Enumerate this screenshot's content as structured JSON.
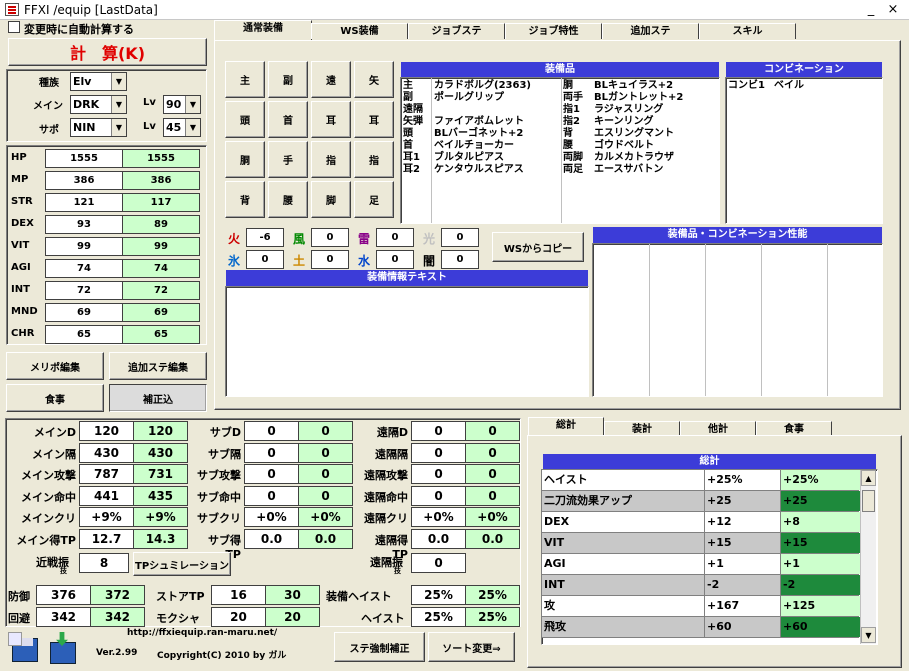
{
  "window": {
    "title": "FFXI /equip [LastData]",
    "minimize": "_",
    "close": "×"
  },
  "left": {
    "auto_calc_label": "変更時に自動計算する",
    "calc_button": "計　算(K)",
    "race_label": "種族",
    "race_value": "Elv",
    "main_label": "メイン",
    "main_value": "DRK",
    "sub_label": "サポ",
    "sub_value": "NIN",
    "lv_label": "Lv",
    "main_lv": "90",
    "sub_lv": "45",
    "stats": [
      {
        "name": "HP",
        "base": "1555",
        "total": "1555"
      },
      {
        "name": "MP",
        "base": "386",
        "total": "386"
      },
      {
        "name": "STR",
        "base": "121",
        "total": "117"
      },
      {
        "name": "DEX",
        "base": "93",
        "total": "89"
      },
      {
        "name": "VIT",
        "base": "99",
        "total": "99"
      },
      {
        "name": "AGI",
        "base": "74",
        "total": "74"
      },
      {
        "name": "INT",
        "base": "72",
        "total": "72"
      },
      {
        "name": "MND",
        "base": "69",
        "total": "69"
      },
      {
        "name": "CHR",
        "base": "65",
        "total": "65"
      }
    ],
    "merit_button": "メリポ編集",
    "extra_button": "追加ステ編集",
    "food_button": "食事",
    "correct_button": "補正込"
  },
  "tabs": [
    "通常装備",
    "WS装備",
    "ジョブステ",
    "ジョブ特性",
    "追加ステ",
    "スキル"
  ],
  "slots": [
    "主",
    "副",
    "遠",
    "矢",
    "頭",
    "首",
    "耳",
    "耳",
    "胴",
    "手",
    "指",
    "指",
    "背",
    "腰",
    "脚",
    "足"
  ],
  "equipment": {
    "header": "装備品",
    "left_slots": "主\n副\n遠隔\n矢弾\n頭\n首\n耳1\n耳2",
    "left_items": "カラドボルグ(2363)\nポールグリップ\n\nファイアボムレット\nBLバーゴネット+2\nベイルチョーカー\nブルタルピアス\nケンタウルスピアス",
    "right_slots": "胴\n両手\n指1\n指2\n背\n腰\n両脚\n両足",
    "right_items": "BLキュイラス+2\nBLガントレット+2\nラジャスリング\nキーンリング\nエスリングマント\nゴウドベルト\nカルメカトラウザ\nエースサバトン"
  },
  "combination": {
    "header": "コンビネーション",
    "label": "コンビ1",
    "value": "ベイル"
  },
  "elements": [
    {
      "name": "火",
      "value": "-6",
      "color": "#cc0000"
    },
    {
      "name": "風",
      "value": "0",
      "color": "#008800"
    },
    {
      "name": "雷",
      "value": "0",
      "color": "#880088"
    },
    {
      "name": "光",
      "value": "0",
      "color": "#c0c0c0"
    },
    {
      "name": "氷",
      "value": "0",
      "color": "#0066cc"
    },
    {
      "name": "土",
      "value": "0",
      "color": "#cc8800"
    },
    {
      "name": "水",
      "value": "0",
      "color": "#0044cc"
    },
    {
      "name": "闇",
      "value": "0",
      "color": "#000000"
    }
  ],
  "ws_copy_button": "WSからコピー",
  "equip_info_header": "装備情報テキスト",
  "combo_perf_header": "装備品・コンビネーション性能",
  "bottom": {
    "main": [
      {
        "label": "メインD",
        "a": "120",
        "b": "120"
      },
      {
        "label": "メイン隔",
        "a": "430",
        "b": "430"
      },
      {
        "label": "メイン攻撃",
        "a": "787",
        "b": "731"
      },
      {
        "label": "メイン命中",
        "a": "441",
        "b": "435"
      },
      {
        "label": "メインクリ",
        "a": "+9%",
        "b": "+9%"
      },
      {
        "label": "メイン得TP",
        "a": "12.7",
        "b": "14.3"
      }
    ],
    "sub": [
      {
        "label": "サブD",
        "a": "0",
        "b": "0"
      },
      {
        "label": "サブ隔",
        "a": "0",
        "b": "0"
      },
      {
        "label": "サブ攻撃",
        "a": "0",
        "b": "0"
      },
      {
        "label": "サブ命中",
        "a": "0",
        "b": "0"
      },
      {
        "label": "サブクリ",
        "a": "+0%",
        "b": "+0%"
      },
      {
        "label": "サブ得TP",
        "a": "0.0",
        "b": "0.0"
      }
    ],
    "ranged": [
      {
        "label": "遠隔D",
        "a": "0",
        "b": "0"
      },
      {
        "label": "遠隔隔",
        "a": "0",
        "b": "0"
      },
      {
        "label": "遠隔攻撃",
        "a": "0",
        "b": "0"
      },
      {
        "label": "遠隔命中",
        "a": "0",
        "b": "0"
      },
      {
        "label": "遠隔クリ",
        "a": "+0%",
        "b": "+0%"
      },
      {
        "label": "遠隔得TP",
        "a": "0.0",
        "b": "0.0"
      }
    ],
    "melee_skill_label": "近戦振",
    "melee_skill_sub": "技",
    "melee_skill_value": "8",
    "tp_sim_button": "TPシュミレーション",
    "ranged_skill_label": "遠隔振",
    "ranged_skill_sub": "技",
    "ranged_skill_value": "0",
    "defense_label": "防御",
    "defense_a": "376",
    "defense_b": "372",
    "evasion_label": "回避",
    "evasion_a": "342",
    "evasion_b": "342",
    "storetp_label": "ストアTP",
    "storetp_a": "16",
    "storetp_b": "30",
    "mokusha_label": "モクシャ",
    "mokusha_a": "20",
    "mokusha_b": "20",
    "eq_haste_label": "装備ヘイスト",
    "eq_haste_a": "25%",
    "eq_haste_b": "25%",
    "haste_label": "ヘイスト",
    "haste_a": "25%",
    "haste_b": "25%"
  },
  "footer": {
    "url": "http://ffxiequip.ran-maru.net/",
    "version": "Ver.2.99",
    "copyright": "Copyright(C) 2010 by ガル",
    "force_button": "ステ強制補正",
    "sort_button": "ソート変更⇒"
  },
  "right_tabs": [
    "総計",
    "装計",
    "他計",
    "食事"
  ],
  "totals": {
    "header": "総計",
    "rows": [
      {
        "name": "ヘイスト",
        "a": "+25%",
        "b": "+25%",
        "shade": "light"
      },
      {
        "name": "二刀流効果アップ",
        "a": "+25",
        "b": "+25",
        "shade": "dark"
      },
      {
        "name": "DEX",
        "a": "+12",
        "b": "+8",
        "shade": "light"
      },
      {
        "name": "VIT",
        "a": "+15",
        "b": "+15",
        "shade": "dark"
      },
      {
        "name": "AGI",
        "a": "+1",
        "b": "+1",
        "shade": "light"
      },
      {
        "name": "INT",
        "a": "-2",
        "b": "-2",
        "shade": "dark"
      },
      {
        "name": "攻",
        "a": "+167",
        "b": "+125",
        "shade": "light"
      },
      {
        "name": "飛攻",
        "a": "+60",
        "b": "+60",
        "shade": "dark"
      }
    ]
  }
}
